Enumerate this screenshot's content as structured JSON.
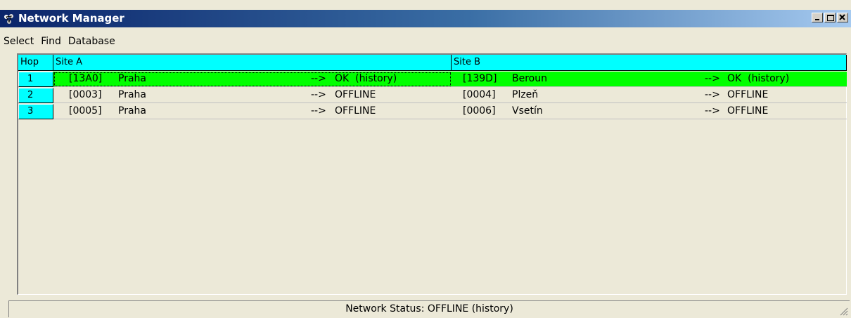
{
  "window": {
    "title": "Network Manager"
  },
  "menu": [
    "Select",
    "Find",
    "Database"
  ],
  "grid": {
    "headers": {
      "hop": "Hop",
      "site_a": "Site A",
      "site_b": "Site B"
    },
    "rows": [
      {
        "hop": "1",
        "a": {
          "code": "[13A0]",
          "name": "Praha",
          "arrow": "-->",
          "status": "OK  (history)"
        },
        "b": {
          "code": "[139D]",
          "name": "Beroun",
          "arrow": "-->",
          "status": "OK  (history)"
        }
      },
      {
        "hop": "2",
        "a": {
          "code": "[0003]",
          "name": "Praha",
          "arrow": "-->",
          "status": "OFFLINE"
        },
        "b": {
          "code": "[0004]",
          "name": "Plzeň",
          "arrow": "-->",
          "status": "OFFLINE"
        }
      },
      {
        "hop": "3",
        "a": {
          "code": "[0005]",
          "name": "Praha",
          "arrow": "-->",
          "status": "OFFLINE"
        },
        "b": {
          "code": "[0006]",
          "name": "Vsetín",
          "arrow": "-->",
          "status": "OFFLINE"
        }
      }
    ]
  },
  "status_bar": "Network Status: OFFLINE (history)",
  "colors": {
    "header_cyan": "#00ffff",
    "ok_green": "#00ff00",
    "window_bg": "#ece9d8"
  }
}
